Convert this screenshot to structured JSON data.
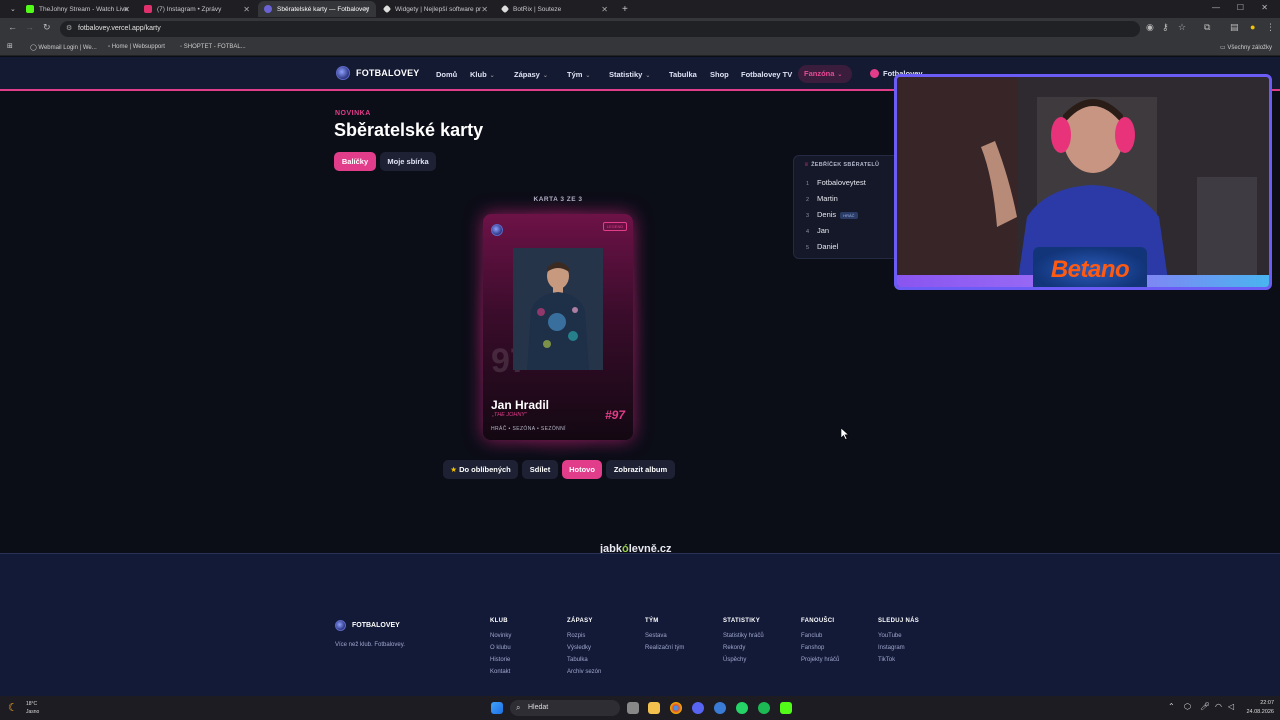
{
  "browser": {
    "tabs": [
      {
        "label": "TheJohny Stream - Watch Live",
        "favicon_color": "#53fc18"
      },
      {
        "label": "(7) Instagram • Zprávy",
        "favicon_color": "#e1306c"
      },
      {
        "label": "Sběratelské karty — Fotbalovey",
        "favicon_color": "#6b63d4",
        "active": true
      },
      {
        "label": "Widgety | Nejlepší software pr",
        "favicon_color": "#dddddd"
      },
      {
        "label": "BotRix | Souteze",
        "favicon_color": "#dddddd"
      }
    ],
    "url": "fotbalovey.vercel.app/karty",
    "bookmarks": [
      "Webmail Login | We...",
      "Home | Websupport",
      "SHOPTET - FOTBAL..."
    ],
    "bookmarks_right": "Všechny záložky"
  },
  "site": {
    "brand": "FOTBALOVEY",
    "nav": [
      {
        "label": "Domů",
        "dropdown": false
      },
      {
        "label": "Klub",
        "dropdown": true
      },
      {
        "label": "Zápasy",
        "dropdown": true
      },
      {
        "label": "Tým",
        "dropdown": true
      },
      {
        "label": "Statistiky",
        "dropdown": true
      },
      {
        "label": "Tabulka",
        "dropdown": false
      },
      {
        "label": "Shop",
        "dropdown": false
      },
      {
        "label": "Fotbalovey TV",
        "dropdown": false
      }
    ],
    "fanzona": "Fanzóna",
    "user": "Fotbalovey",
    "accent": "#e23d8a"
  },
  "page": {
    "overline": "NOVINKA",
    "title": "Sběratelské karty",
    "tabs": {
      "packs": "Balíčky",
      "collection": "Moje sbírka"
    },
    "card_counter": "KARTA 3 ZE 3",
    "card": {
      "badge": "LEGEND",
      "big_number": "97",
      "name": "Jan Hradil",
      "nickname": "„THE JOHNY\"",
      "number": "#97",
      "meta": "HRÁČ • SEZÓNA • SEZÓNNÍ"
    },
    "actions": {
      "favorite": "Do oblíbených",
      "share": "Sdílet",
      "done": "Hotovo",
      "album": "Zobrazit album"
    }
  },
  "leaderboard": {
    "title": "ŽEBŘÍČEK SBĚRATELŮ",
    "rows": [
      {
        "rank": "1",
        "name": "Fotbaloveytest"
      },
      {
        "rank": "2",
        "name": "Martin"
      },
      {
        "rank": "3",
        "name": "Denis",
        "tag": "HRÁČ"
      },
      {
        "rank": "4",
        "name": "Jan"
      },
      {
        "rank": "5",
        "name": "Daniel"
      }
    ]
  },
  "stream_overlay": {
    "sponsor": "Betano"
  },
  "sponsor_banner": {
    "part1": "jabk",
    "part2": "ó",
    "part3": "levně.cz"
  },
  "footer": {
    "brand": "FOTBALOVEY",
    "tagline": "Více než klub. Fotbalovey.",
    "columns": [
      {
        "title": "KLUB",
        "links": [
          "Novinky",
          "O klubu",
          "Historie",
          "Kontakt"
        ]
      },
      {
        "title": "ZÁPASY",
        "links": [
          "Rozpis",
          "Výsledky",
          "Tabulka",
          "Archiv sezón"
        ]
      },
      {
        "title": "TÝM",
        "links": [
          "Sestava",
          "Realizační tým"
        ]
      },
      {
        "title": "STATISTIKY",
        "links": [
          "Statistiky hráčů",
          "Rekordy",
          "Úspěchy"
        ]
      },
      {
        "title": "FANOUŠCI",
        "links": [
          "Fanclub",
          "Fanshop",
          "Projekty hráčů"
        ]
      },
      {
        "title": "SLEDUJ NÁS",
        "links": [
          "YouTube",
          "Instagram",
          "TikTok"
        ]
      }
    ]
  },
  "taskbar": {
    "weather_temp": "18°C",
    "weather_desc": "Jasno",
    "search": "Hledat",
    "time": "22:07",
    "date": "24.08.2026"
  }
}
